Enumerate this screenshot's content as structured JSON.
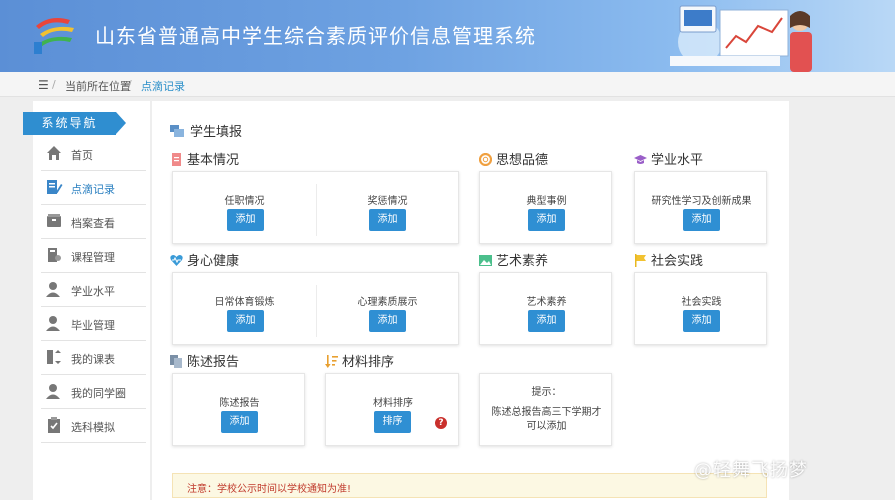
{
  "header": {
    "title": "山东省普通高中学生综合素质评价信息管理系统"
  },
  "breadcrumb": {
    "icon": "menu-icon",
    "sep": "/",
    "current_location": "当前所在位置",
    "page": "点滴记录"
  },
  "sidebar": {
    "heading": "系统导航",
    "items": [
      {
        "label": "首页",
        "icon": "home-icon"
      },
      {
        "label": "点滴记录",
        "icon": "edit-icon",
        "active": true
      },
      {
        "label": "档案查看",
        "icon": "archive-icon"
      },
      {
        "label": "课程管理",
        "icon": "course-icon"
      },
      {
        "label": "学业水平",
        "icon": "user-icon"
      },
      {
        "label": "毕业管理",
        "icon": "user-icon"
      },
      {
        "label": "我的课表",
        "icon": "schedule-icon"
      },
      {
        "label": "我的同学圈",
        "icon": "user-icon"
      },
      {
        "label": "选科模拟",
        "icon": "checklist-icon"
      }
    ]
  },
  "main": {
    "section_title": "学生填报",
    "categories": {
      "basic": {
        "title": "基本情况",
        "items": [
          {
            "label": "任职情况",
            "button": "添加"
          },
          {
            "label": "奖惩情况",
            "button": "添加"
          }
        ]
      },
      "moral": {
        "title": "思想品德",
        "items": [
          {
            "label": "典型事例",
            "button": "添加"
          }
        ]
      },
      "academic": {
        "title": "学业水平",
        "items": [
          {
            "label": "研究性学习及创新成果",
            "button": "添加"
          }
        ]
      },
      "health": {
        "title": "身心健康",
        "items": [
          {
            "label": "日常体育锻炼",
            "button": "添加"
          },
          {
            "label": "心理素质展示",
            "button": "添加"
          }
        ]
      },
      "art": {
        "title": "艺术素养",
        "items": [
          {
            "label": "艺术素养",
            "button": "添加"
          }
        ]
      },
      "social": {
        "title": "社会实践",
        "items": [
          {
            "label": "社会实践",
            "button": "添加"
          }
        ]
      },
      "report": {
        "title": "陈述报告",
        "items": [
          {
            "label": "陈述报告",
            "button": "添加"
          }
        ]
      },
      "sort": {
        "title": "材料排序",
        "items": [
          {
            "label": "材料排序",
            "button": "排序"
          }
        ],
        "help": "?"
      }
    },
    "tip": {
      "title": "提示：",
      "line1": "陈述总报告高三下学期才",
      "line2": "可以添加"
    },
    "notice": "注意：学校公示时间以学校通知为准!"
  },
  "watermark": "@轻舞飞扬梦",
  "colors": {
    "header": "#6ea2e2",
    "primary": "#2f8fd3",
    "notice_text": "#c0392b",
    "notice_bg": "#fcf8e3"
  }
}
